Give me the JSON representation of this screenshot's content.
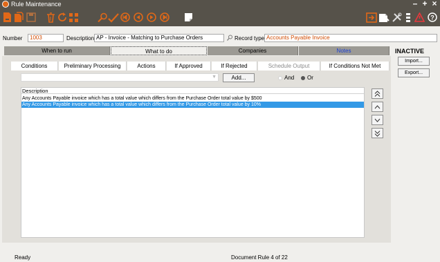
{
  "window": {
    "title": "Rule Maintenance",
    "controls": [
      "minimize",
      "maximize",
      "close"
    ]
  },
  "toolbar": {
    "left_icons": [
      "new-document-icon",
      "copy-document-icon",
      "save-icon",
      "delete-bin-icon",
      "refresh-icon",
      "hierarchy-icon",
      "search-icon",
      "approve-pen-icon",
      "first-record-icon",
      "previous-record-icon",
      "next-record-icon",
      "last-record-icon",
      "notes-page-icon"
    ],
    "right_icons": [
      "exit-icon",
      "attach-icon",
      "tools-icon",
      "pipeline-icon",
      "alert-icon",
      "help-icon"
    ]
  },
  "fields": {
    "number_label": "Number",
    "number_value": "1003",
    "description_label": "Description",
    "description_value": "AP - Invoice - Matching to Purchase Orders",
    "record_type_label": "Record type",
    "record_type_value": "Accounts Payable Invoice"
  },
  "main_tabs": [
    {
      "label": "When to run",
      "active": false
    },
    {
      "label": "What to do",
      "active": true
    },
    {
      "label": "Companies",
      "active": false
    },
    {
      "label": "Notes",
      "active": false
    }
  ],
  "status_flag": "INACTIVE",
  "side_buttons": {
    "import": "Import...",
    "export": "Export..."
  },
  "sub_tabs": [
    {
      "label": "Conditions",
      "enabled": true
    },
    {
      "label": "Preliminary Processing",
      "enabled": true
    },
    {
      "label": "Actions",
      "enabled": true
    },
    {
      "label": "If Approved",
      "enabled": true
    },
    {
      "label": "If Rejected",
      "enabled": true
    },
    {
      "label": "Schedule Output",
      "enabled": false
    },
    {
      "label": "If Conditions Not Met",
      "enabled": true
    }
  ],
  "add_controls": {
    "add_label": "Add...",
    "and_label": "And",
    "or_label": "Or",
    "selected": "Or"
  },
  "list": {
    "header": "Description",
    "rows": [
      {
        "text": "Any Accounts Payable invoice which has a total value which differs from the Purchase Order total value by $500",
        "selected": false
      },
      {
        "text": "Any Accounts Payable invoice which has a total value which differs from the Purchase Order total value by 10%",
        "selected": true
      }
    ]
  },
  "status": {
    "left": "Ready",
    "center": "Document Rule 4 of 22"
  },
  "colors": {
    "chrome": "#56524a",
    "accent_orange": "#e06818",
    "selection": "#3399e6",
    "notes_tab_text": "#1a3fd6"
  }
}
